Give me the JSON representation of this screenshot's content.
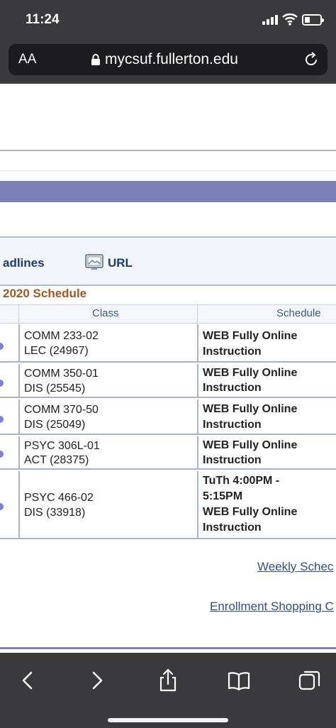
{
  "status_bar": {
    "time": "11:24"
  },
  "browser": {
    "text_size_label": "AA",
    "address": "mycsuf.fullerton.edu"
  },
  "page": {
    "headlines_label": "adlines",
    "url_label": "URL",
    "schedule_title": "2020 Schedule",
    "table": {
      "headers": {
        "class": "Class",
        "schedule": "Schedule"
      },
      "rows": [
        {
          "class_line1": "COMM 233-02",
          "class_line2": "LEC (24967)",
          "schedule_lines": [
            "WEB Fully Online",
            "Instruction"
          ]
        },
        {
          "class_line1": "COMM 350-01",
          "class_line2": "DIS (25545)",
          "schedule_lines": [
            "WEB Fully Online",
            "Instruction"
          ]
        },
        {
          "class_line1": "COMM 370-50",
          "class_line2": "DIS (25049)",
          "schedule_lines": [
            "WEB Fully Online",
            "Instruction"
          ]
        },
        {
          "class_line1": "PSYC 306L-01",
          "class_line2": "ACT (28375)",
          "schedule_lines": [
            "WEB Fully Online",
            "Instruction"
          ]
        },
        {
          "class_line1": "PSYC 466-02",
          "class_line2": "DIS (33918)",
          "schedule_lines": [
            "TuTh 4:00PM -",
            "5:15PM",
            "WEB Fully Online",
            "Instruction"
          ]
        }
      ]
    },
    "links": {
      "weekly": "Weekly Schec",
      "enrollment": "Enrollment Shopping C"
    }
  },
  "icons": {
    "lock": "lock-icon",
    "reload": "reload-icon",
    "url": "url-icon",
    "back": "back-icon",
    "forward": "forward-icon",
    "share": "share-icon",
    "bookmarks": "bookmarks-icon",
    "tabs": "tabs-icon"
  },
  "colors": {
    "chrome": "#3a3a3c",
    "accent_bar": "#7b80b8",
    "title_orange": "#a05a1e",
    "link_blue": "#2e4f8c"
  }
}
